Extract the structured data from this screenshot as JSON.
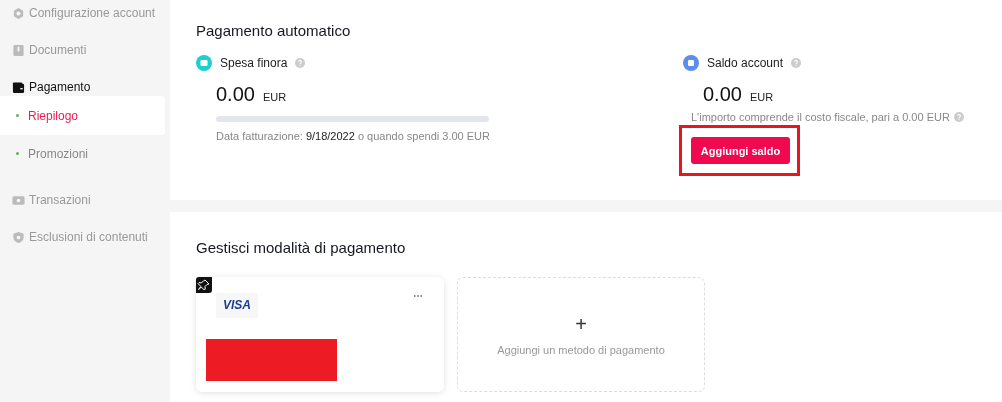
{
  "sidebar": {
    "items": [
      {
        "label": "Configurazione account",
        "expanded": false
      },
      {
        "label": "Documenti",
        "expanded": false
      },
      {
        "label": "Pagamento",
        "expanded": true,
        "children": [
          {
            "label": "Riepilogo",
            "selected": true
          },
          {
            "label": "Promozioni",
            "selected": false
          }
        ]
      },
      {
        "label": "Transazioni",
        "expanded": false
      },
      {
        "label": "Esclusioni di contenuti",
        "expanded": false
      }
    ]
  },
  "auto_payment": {
    "title": "Pagamento automatico",
    "spend": {
      "label": "Spesa finora",
      "amount": "0.00",
      "currency": "EUR",
      "level": 0,
      "note": "Data fatturazione: **9/18/2022** o quando spendi 3.00 EUR"
    },
    "balance": {
      "label": "Saldo account",
      "amount": "0.00",
      "currency": "EUR",
      "note": "L'importo comprende il costo fiscale, pari a 0.00 EUR",
      "button": "Aggiungi saldo",
      "highlighted": true
    }
  },
  "payment_methods": {
    "title": "Gestisci modalità di pagamento",
    "card": {
      "brand": "VISA",
      "pinned": true,
      "redacted": true
    },
    "add_label": "Aggiungi un metodo di pagamento",
    "add_symbol": "+"
  }
}
